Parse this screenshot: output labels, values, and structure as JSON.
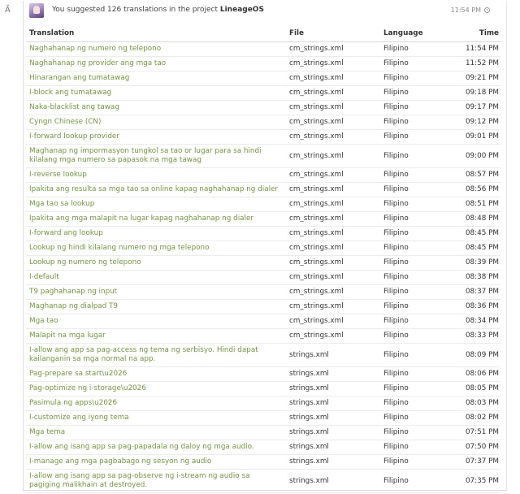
{
  "activity_icon": "translate-icon",
  "header": {
    "summary_prefix": "You suggested 126 translations in the project",
    "project": "LineageOS",
    "timestamp": "11:54 PM"
  },
  "table": {
    "columns": [
      "Translation",
      "File",
      "Language",
      "Time"
    ],
    "rows": [
      {
        "translation": "Naghahanap ng numero ng telepono",
        "file": "cm_strings.xml",
        "language": "Filipino",
        "time": "11:54 PM"
      },
      {
        "translation": "Naghahanap ng provider ang mga tao",
        "file": "cm_strings.xml",
        "language": "Filipino",
        "time": "11:52 PM"
      },
      {
        "translation": "Hinarangan ang tumatawag",
        "file": "cm_strings.xml",
        "language": "Filipino",
        "time": "09:21 PM"
      },
      {
        "translation": "I-block ang tumatawag",
        "file": "cm_strings.xml",
        "language": "Filipino",
        "time": "09:18 PM"
      },
      {
        "translation": "Naka-blacklist ang tawag",
        "file": "cm_strings.xml",
        "language": "Filipino",
        "time": "09:17 PM"
      },
      {
        "translation": "Cyngn Chinese (CN)",
        "file": "cm_strings.xml",
        "language": "Filipino",
        "time": "09:12 PM"
      },
      {
        "translation": "I-forward lookup provider",
        "file": "cm_strings.xml",
        "language": "Filipino",
        "time": "09:01 PM"
      },
      {
        "translation": "Maghanap ng impormasyon tungkol sa tao or lugar para sa hindi kilalang mga numero sa papasok na mga tawag",
        "file": "cm_strings.xml",
        "language": "Filipino",
        "time": "09:00 PM",
        "tall": true
      },
      {
        "translation": "I-reverse lookup",
        "file": "cm_strings.xml",
        "language": "Filipino",
        "time": "08:57 PM"
      },
      {
        "translation": "Ipakita ang resulta sa mga tao sa online kapag naghahanap ng dialer",
        "file": "cm_strings.xml",
        "language": "Filipino",
        "time": "08:56 PM"
      },
      {
        "translation": "Mga tao sa lookup",
        "file": "cm_strings.xml",
        "language": "Filipino",
        "time": "08:51 PM"
      },
      {
        "translation": "Ipakita ang mga malapit na lugar kapag naghahanap ng dialer",
        "file": "cm_strings.xml",
        "language": "Filipino",
        "time": "08:48 PM"
      },
      {
        "translation": "I-forward ang lookup",
        "file": "cm_strings.xml",
        "language": "Filipino",
        "time": "08:45 PM"
      },
      {
        "translation": "Lookup ng hindi kilalang numero ng mga telepono",
        "file": "cm_strings.xml",
        "language": "Filipino",
        "time": "08:45 PM"
      },
      {
        "translation": "Lookup ng numero ng telepono",
        "file": "cm_strings.xml",
        "language": "Filipino",
        "time": "08:39 PM"
      },
      {
        "translation": "I-default",
        "file": "cm_strings.xml",
        "language": "Filipino",
        "time": "08:38 PM"
      },
      {
        "translation": "T9 paghahanap ng input",
        "file": "cm_strings.xml",
        "language": "Filipino",
        "time": "08:37 PM"
      },
      {
        "translation": "Maghanap ng dialpad T9",
        "file": "cm_strings.xml",
        "language": "Filipino",
        "time": "08:36 PM"
      },
      {
        "translation": "Mga tao",
        "file": "cm_strings.xml",
        "language": "Filipino",
        "time": "08:34 PM"
      },
      {
        "translation": "Malapit na mga lugar",
        "file": "cm_strings.xml",
        "language": "Filipino",
        "time": "08:33 PM"
      },
      {
        "translation": "I-allow ang app sa pag-access ng tema ng serbisyo. Hindi dapat kailanganin sa mga normal na app.",
        "file": "strings.xml",
        "language": "Filipino",
        "time": "08:09 PM",
        "tall": true
      },
      {
        "translation": "Pag-prepare sa start\\u2026",
        "file": "strings.xml",
        "language": "Filipino",
        "time": "08:06 PM"
      },
      {
        "translation": "Pag-optimize ng i-storage\\u2026",
        "file": "strings.xml",
        "language": "Filipino",
        "time": "08:05 PM"
      },
      {
        "translation": "Pasimula ng apps\\u2026",
        "file": "strings.xml",
        "language": "Filipino",
        "time": "08:03 PM"
      },
      {
        "translation": "I-customize ang iyong tema",
        "file": "strings.xml",
        "language": "Filipino",
        "time": "08:02 PM"
      },
      {
        "translation": "Mga tema",
        "file": "strings.xml",
        "language": "Filipino",
        "time": "07:51 PM"
      },
      {
        "translation": "I-allow ang isang app sa pag-papadala ng daloy ng mga audio.",
        "file": "strings.xml",
        "language": "Filipino",
        "time": "07:50 PM"
      },
      {
        "translation": "I-manage ang mga pagbabago ng sesyon ng audio",
        "file": "strings.xml",
        "language": "Filipino",
        "time": "07:37 PM"
      },
      {
        "translation": "I-allow ang isang app sa pag-observe ng i-stream ng audio sa pagiging malikhain at destroyed.",
        "file": "strings.xml",
        "language": "Filipino",
        "time": "07:35 PM",
        "tall": true
      }
    ]
  }
}
